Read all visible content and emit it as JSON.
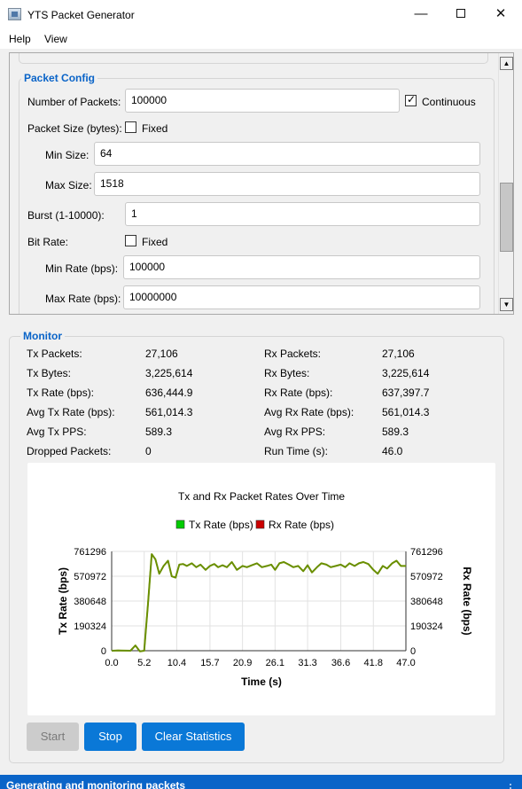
{
  "window": {
    "title": "YTS Packet Generator"
  },
  "menu": {
    "items": [
      "Help",
      "View"
    ]
  },
  "packet_config": {
    "group_title": "Packet Config",
    "num_packets_label": "Number of Packets:",
    "num_packets_value": "100000",
    "continuous_label": "Continuous",
    "continuous_checked": true,
    "packet_size_label": "Packet Size (bytes):",
    "fixed_label": "Fixed",
    "packet_size_fixed_checked": false,
    "min_size_label": "Min Size:",
    "min_size_value": "64",
    "max_size_label": "Max Size:",
    "max_size_value": "1518",
    "burst_label": "Burst (1-10000):",
    "burst_value": "1",
    "bit_rate_label": "Bit Rate:",
    "bit_rate_fixed_checked": false,
    "min_rate_label": "Min Rate (bps):",
    "min_rate_value": "100000",
    "max_rate_label": "Max Rate (bps):",
    "max_rate_value": "10000000"
  },
  "monitor": {
    "group_title": "Monitor",
    "tx_packets_label": "Tx Packets:",
    "tx_packets": "27,106",
    "tx_bytes_label": "Tx Bytes:",
    "tx_bytes": "3,225,614",
    "tx_rate_label": "Tx Rate (bps):",
    "tx_rate": "636,444.9",
    "avg_tx_rate_label": "Avg Tx Rate (bps):",
    "avg_tx_rate": "561,014.3",
    "avg_tx_pps_label": "Avg Tx PPS:",
    "avg_tx_pps": "589.3",
    "dropped_label": "Dropped Packets:",
    "dropped": "0",
    "rx_packets_label": "Rx Packets:",
    "rx_packets": "27,106",
    "rx_bytes_label": "Rx Bytes:",
    "rx_bytes": "3,225,614",
    "rx_rate_label": "Rx Rate (bps):",
    "rx_rate": "637,397.7",
    "avg_rx_rate_label": "Avg Rx Rate (bps):",
    "avg_rx_rate": "561,014.3",
    "avg_rx_pps_label": "Avg Rx PPS:",
    "avg_rx_pps": "589.3",
    "run_time_label": "Run Time (s):",
    "run_time": "46.0"
  },
  "buttons": {
    "start": "Start",
    "stop": "Stop",
    "clear": "Clear Statistics"
  },
  "status": {
    "text": "Generating and monitoring packets"
  },
  "colors": {
    "accent": "#0a64c8",
    "button": "#0a78d7",
    "tx_series": "#00cc00",
    "rx_series": "#cc0000",
    "line_visible": "#6a8f00"
  },
  "chart_data": {
    "type": "line",
    "title": "Tx and Rx Packet Rates Over Time",
    "xlabel": "Time (s)",
    "ylabel": "Tx Rate (bps)",
    "ylabel_right": "Rx Rate (bps)",
    "xlim": [
      0,
      47.0
    ],
    "ylim": [
      0,
      761296
    ],
    "x_ticks": [
      "0.0",
      "5.2",
      "10.4",
      "15.7",
      "20.9",
      "26.1",
      "31.3",
      "36.6",
      "41.8",
      "47.0"
    ],
    "y_ticks": [
      "0",
      "190324",
      "380648",
      "570972",
      "761296"
    ],
    "legend_position": "top",
    "grid": true,
    "x": [
      0,
      1,
      2,
      3,
      3.8,
      4.5,
      5.2,
      5.8,
      6.4,
      7,
      7.6,
      8.3,
      9,
      9.6,
      10.2,
      10.8,
      11.4,
      12,
      12.8,
      13.5,
      14.2,
      15,
      15.7,
      16.4,
      17,
      17.7,
      18.4,
      19.2,
      20,
      20.9,
      21.6,
      22.4,
      23.2,
      24,
      24.8,
      25.5,
      26.1,
      26.8,
      27.5,
      28.3,
      29,
      29.8,
      30.6,
      31.3,
      32,
      32.8,
      33.5,
      34.3,
      35,
      35.8,
      36.6,
      37.3,
      38,
      38.8,
      39.5,
      40.2,
      41,
      41.8,
      42.5,
      43.3,
      44,
      44.8,
      45.5,
      46.2,
      47
    ],
    "series": [
      {
        "name": "Tx Rate (bps)",
        "values": [
          0,
          2000,
          1000,
          0,
          40000,
          -5000,
          0,
          360000,
          740000,
          700000,
          590000,
          650000,
          690000,
          570000,
          560000,
          660000,
          665000,
          650000,
          670000,
          640000,
          660000,
          620000,
          650000,
          665000,
          640000,
          655000,
          640000,
          680000,
          620000,
          650000,
          640000,
          655000,
          670000,
          640000,
          650000,
          660000,
          620000,
          670000,
          680000,
          660000,
          640000,
          650000,
          610000,
          655000,
          600000,
          640000,
          670000,
          660000,
          640000,
          650000,
          660000,
          640000,
          670000,
          650000,
          670000,
          680000,
          665000,
          620000,
          590000,
          650000,
          630000,
          670000,
          690000,
          650000,
          650000
        ]
      },
      {
        "name": "Rx Rate (bps)",
        "values": [
          0,
          2000,
          1000,
          0,
          40000,
          -5000,
          0,
          360000,
          740000,
          700000,
          590000,
          650000,
          690000,
          570000,
          560000,
          660000,
          665000,
          650000,
          670000,
          640000,
          660000,
          620000,
          650000,
          665000,
          640000,
          655000,
          640000,
          680000,
          620000,
          650000,
          640000,
          655000,
          670000,
          640000,
          650000,
          660000,
          620000,
          670000,
          680000,
          660000,
          640000,
          650000,
          610000,
          655000,
          600000,
          640000,
          670000,
          660000,
          640000,
          650000,
          660000,
          640000,
          670000,
          650000,
          670000,
          680000,
          665000,
          620000,
          590000,
          650000,
          630000,
          670000,
          690000,
          650000,
          650000
        ]
      }
    ]
  }
}
